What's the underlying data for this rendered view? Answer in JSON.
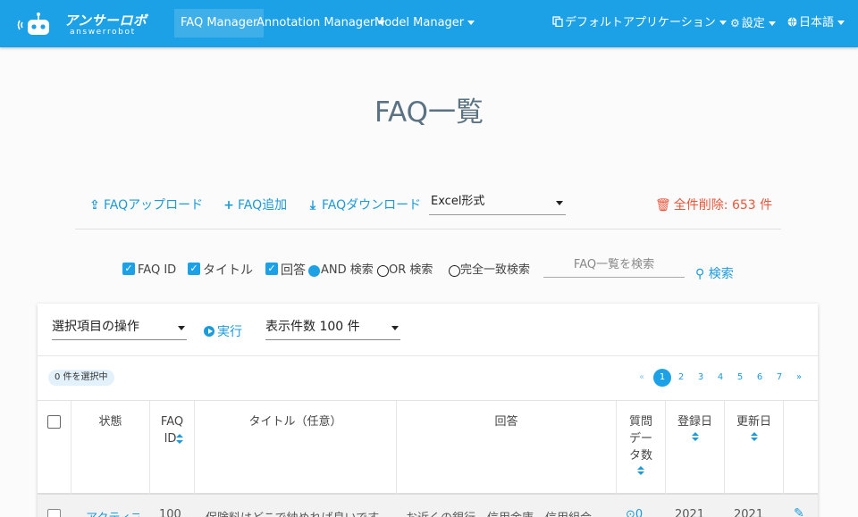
{
  "navbar": {
    "brand": "アンサーロボ",
    "brand_sub": "answerrobot",
    "menu": [
      {
        "label": "FAQ Manager"
      },
      {
        "label": "Annotation Manager"
      },
      {
        "label": "Model Manager"
      }
    ],
    "app_selector": "デフォルトアプリケーション",
    "settings": "設定",
    "language": "日本語"
  },
  "page": {
    "title": "FAQ一覧"
  },
  "actions": {
    "upload": "FAQアップロード",
    "add": "FAQ追加",
    "download": "FAQダウンロード",
    "format_selected": "Excel形式",
    "delete_all": "全件削除: 653 件"
  },
  "search": {
    "filters": [
      {
        "label": "FAQ ID",
        "checked": true
      },
      {
        "label": "タイトル",
        "checked": true
      },
      {
        "label": "回答",
        "checked": true
      }
    ],
    "modes": [
      {
        "label": "AND 検索",
        "selected": true
      },
      {
        "label": "OR 検索",
        "selected": false
      },
      {
        "label": "完全一致検索",
        "selected": false
      }
    ],
    "placeholder": "FAQ一覧を検索",
    "button": "検索"
  },
  "list": {
    "bulk_action": "選択項目の操作",
    "run": "実行",
    "per_page": "表示件数 100 件",
    "selected_badge": "0 件を選択中",
    "pagination": {
      "prev": "«",
      "pages": [
        "1",
        "2",
        "3",
        "4",
        "5",
        "6",
        "7"
      ],
      "next": "»",
      "current": 1
    },
    "columns": {
      "status": "状態",
      "faq_id_1": "FAQ",
      "faq_id_2": "ID",
      "title": "タイトル（任意）",
      "answer": "回答",
      "qdata_1": "質問",
      "qdata_2": "デー",
      "qdata_3": "タ数",
      "created": "登録日",
      "updated": "更新日"
    },
    "rows": [
      {
        "status": "アクティブ",
        "faq_id": "100",
        "title": "保険料はどこで納めれば良いです",
        "answer": "お近くの銀行、信用金庫、信用組合",
        "qdata": "0",
        "created": "2021",
        "updated": "2021"
      }
    ]
  }
}
